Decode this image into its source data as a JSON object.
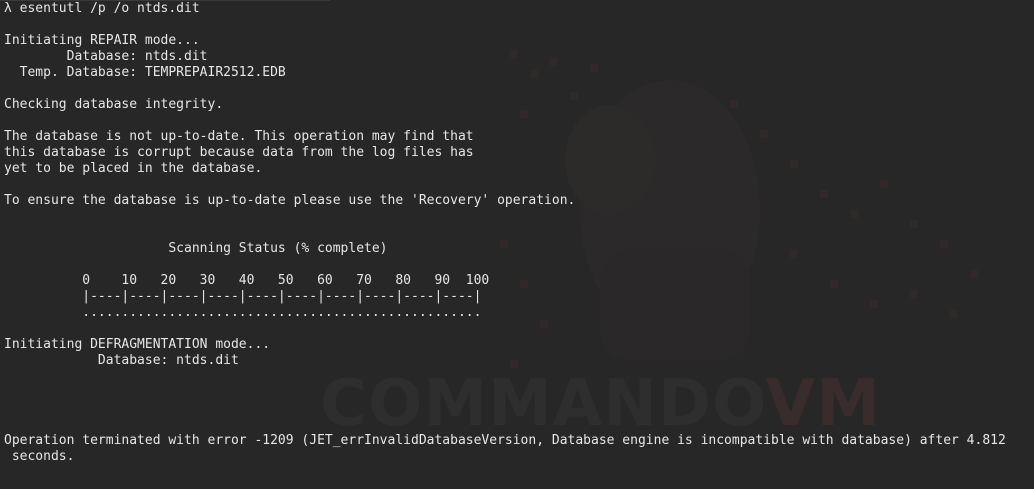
{
  "terminal": {
    "lines": [
      "λ esentutl /p /o ntds.dit",
      "",
      "Initiating REPAIR mode...",
      "        Database: ntds.dit",
      "  Temp. Database: TEMPREPAIR2512.EDB",
      "",
      "Checking database integrity.",
      "",
      "The database is not up-to-date. This operation may find that",
      "this database is corrupt because data from the log files has",
      "yet to be placed in the database.",
      "",
      "To ensure the database is up-to-date please use the 'Recovery' operation.",
      "",
      "",
      "                     Scanning Status (% complete)",
      "",
      "          0    10   20   30   40   50   60   70   80   90  100",
      "          |----|----|----|----|----|----|----|----|----|----|",
      "          ...................................................",
      "",
      "Initiating DEFRAGMENTATION mode...",
      "            Database: ntds.dit",
      "",
      "",
      "",
      "",
      "Operation terminated with error -1209 (JET_errInvalidDatabaseVersion, Database engine is incompatible with database) after 4.812",
      " seconds."
    ],
    "watermark": {
      "text_main": "COMMANDO",
      "text_accent": "VM"
    },
    "colors": {
      "background": "#272727",
      "foreground": "#e6e6e6"
    }
  }
}
